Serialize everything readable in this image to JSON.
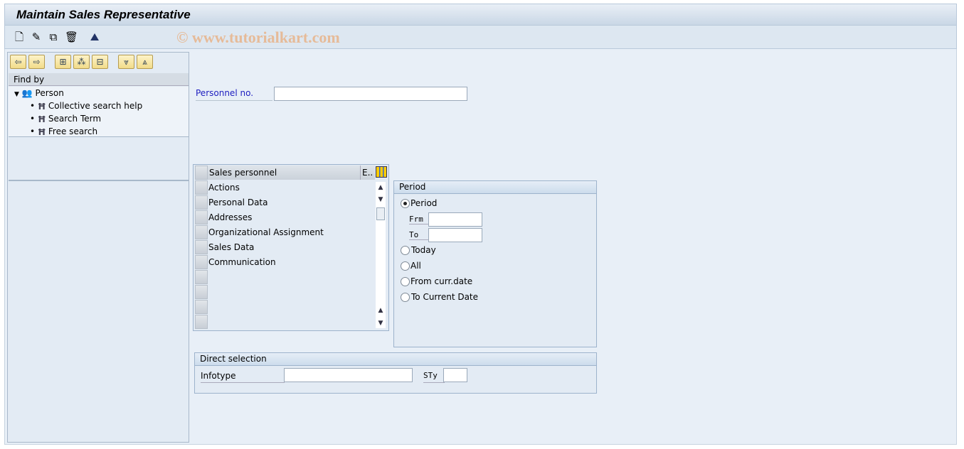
{
  "title": "Maintain Sales Representative",
  "watermark": "© www.tutorialkart.com",
  "toolbar": {
    "icons": [
      "new-document-icon",
      "pencil-edit-icon",
      "copy-icon",
      "trash-delete-icon",
      "person-overview-icon"
    ]
  },
  "nav": {
    "find_by": "Find by",
    "root": "Person",
    "items": [
      "Collective search help",
      "Search Term",
      "Free search"
    ]
  },
  "personnel_label": "Personnel no.",
  "personnel_value": "",
  "table": {
    "header": "Sales personnel",
    "header2": "E..",
    "rows": [
      "Actions",
      "Personal Data",
      "Addresses",
      "Organizational Assignment",
      "Sales Data",
      "Communication"
    ]
  },
  "period": {
    "title": "Period",
    "options": [
      "Period",
      "Today",
      "All",
      "From curr.date",
      "To Current Date"
    ],
    "selected": "Period",
    "from_label": "Frm",
    "to_label": "To",
    "from_value": "",
    "to_value": ""
  },
  "direct": {
    "title": "Direct selection",
    "infotype_label": "Infotype",
    "subtype_label": "STy",
    "infotype_value": "",
    "subtype_value": ""
  }
}
